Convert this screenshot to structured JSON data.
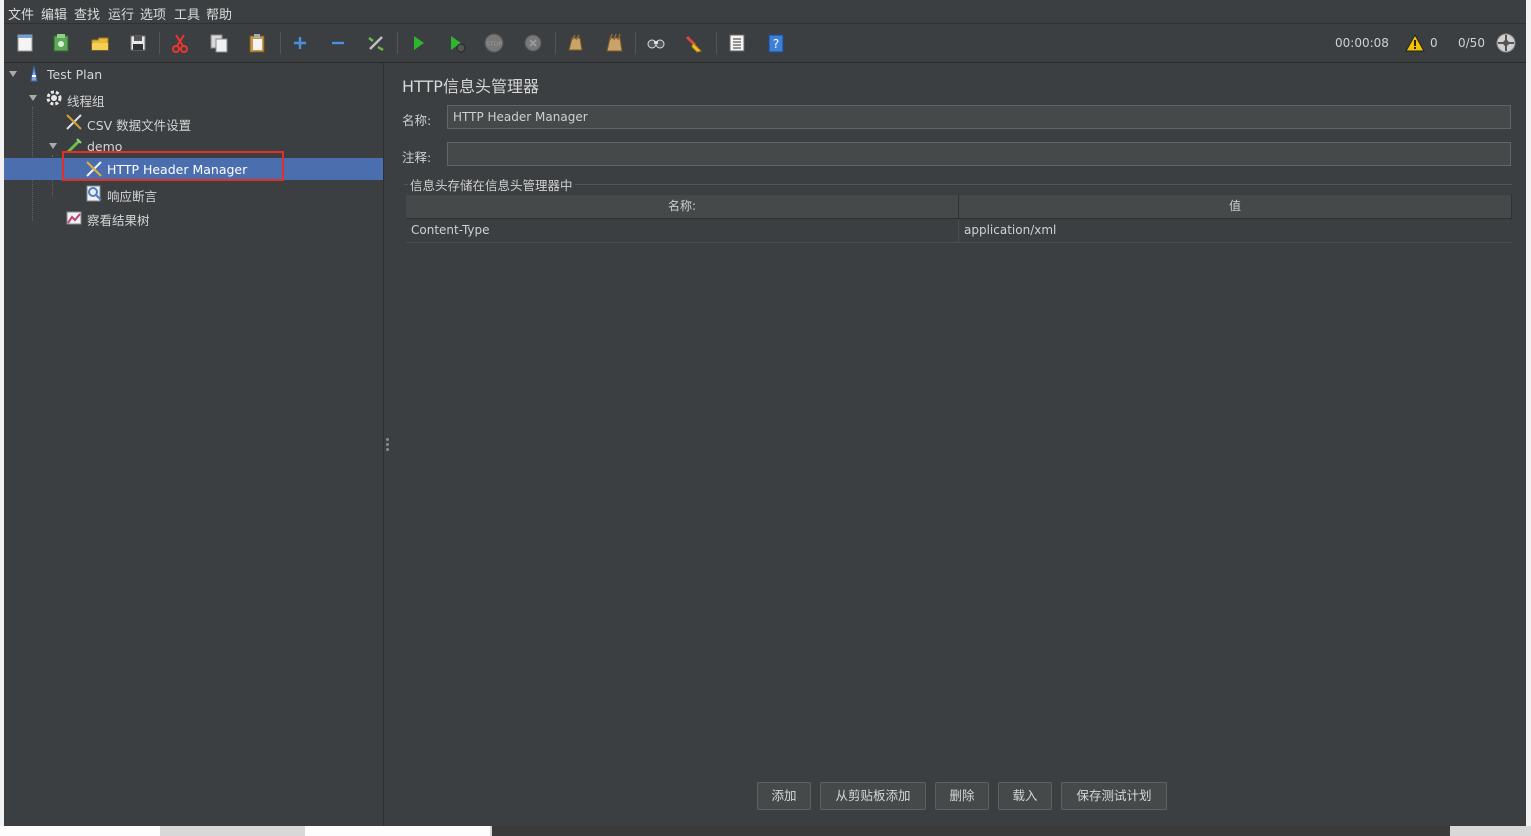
{
  "menu": [
    "文件",
    "编辑",
    "查找",
    "运行",
    "选项",
    "工具",
    "帮助"
  ],
  "toolbar": {
    "icons": [
      "new-icon",
      "templates-icon",
      "open-icon",
      "save-icon",
      "cut-icon",
      "copy-icon",
      "paste-icon",
      "expand-icon",
      "collapse-icon",
      "toggle-icon",
      "start-icon",
      "start-no-pause-icon",
      "stop-icon",
      "shutdown-icon",
      "clear-icon",
      "clear-all-icon",
      "search-icon",
      "reset-search-icon",
      "function-helper-icon",
      "help-icon"
    ],
    "elapsed": "00:00:08",
    "warnings": "0",
    "threads": "0/50"
  },
  "tree": {
    "nodes": [
      {
        "label": "Test Plan",
        "icon": "test-plan-icon"
      },
      {
        "label": "线程组",
        "icon": "thread-group-icon"
      },
      {
        "label": "CSV 数据文件设置",
        "icon": "config-element-icon"
      },
      {
        "label": "demo",
        "icon": "sampler-icon"
      },
      {
        "label": "HTTP Header Manager",
        "icon": "config-element-icon"
      },
      {
        "label": "响应断言",
        "icon": "assertion-icon"
      },
      {
        "label": "察看结果树",
        "icon": "listener-icon"
      }
    ]
  },
  "editor": {
    "title": "HTTP信息头管理器",
    "name_label": "名称:",
    "name_value": "HTTP Header Manager",
    "comment_label": "注释:",
    "comment_value": "",
    "group_title": "信息头存储在信息头管理器中",
    "columns": [
      "名称:",
      "值"
    ],
    "rows": [
      [
        "Content-Type",
        "application/xml"
      ]
    ]
  },
  "buttons": {
    "add": "添加",
    "add_clipboard": "从剪贴板添加",
    "delete": "删除",
    "load": "载入",
    "save_plan": "保存测试计划"
  },
  "colors": {
    "background": "#3c3f41",
    "selection": "#4b6eaf",
    "highlight": "#e0302a"
  }
}
